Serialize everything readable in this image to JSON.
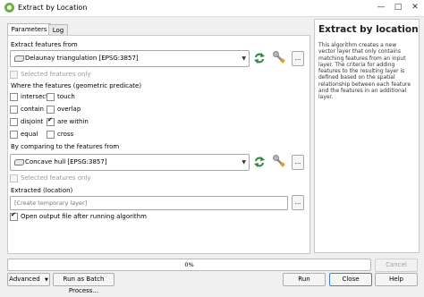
{
  "window": {
    "title": "Extract by Location",
    "minimize_glyph": "—",
    "maximize_glyph": "□",
    "close_glyph": "✕"
  },
  "tabs": [
    {
      "label": "Parameters",
      "active": true
    },
    {
      "label": "Log",
      "active": false
    }
  ],
  "params": {
    "extract_label": "Extract features from",
    "extract_layer": "Delaunay triangulation [EPSG:3857]",
    "selected_only_1": "Selected features only",
    "predicate_label": "Where the features (geometric predicate)",
    "predicates": {
      "intersect": "intersect",
      "touch": "touch",
      "contain": "contain",
      "overlap": "overlap",
      "disjoint": "disjoint",
      "are_within": "are within",
      "equal": "equal",
      "cross": "cross"
    },
    "compare_label": "By comparing to the features from",
    "compare_layer": "Concave hull [EPSG:3857]",
    "selected_only_2": "Selected features only",
    "extracted_label": "Extracted (location)",
    "extracted_placeholder": "[Create temporary layer]",
    "open_output": "Open output file after running algorithm",
    "ellipsis": "..."
  },
  "help": {
    "title": "Extract by location",
    "body": "This algorithm creates a new vector layer that only contains matching features from an input layer. The criteria for adding features to the resulting layer is defined based on the spatial relationship between each feature and the features in an additional layer."
  },
  "progress": {
    "value": 0,
    "text": "0%",
    "color": "#3ea23e"
  },
  "buttons": {
    "cancel": "Cancel",
    "advanced": "Advanced",
    "batch": "Run as Batch Process...",
    "run": "Run",
    "close": "Close",
    "help": "Help"
  },
  "icons": {
    "iterate": "iterate-icon",
    "wrench": "wrench-icon",
    "app": "qgis-icon"
  }
}
